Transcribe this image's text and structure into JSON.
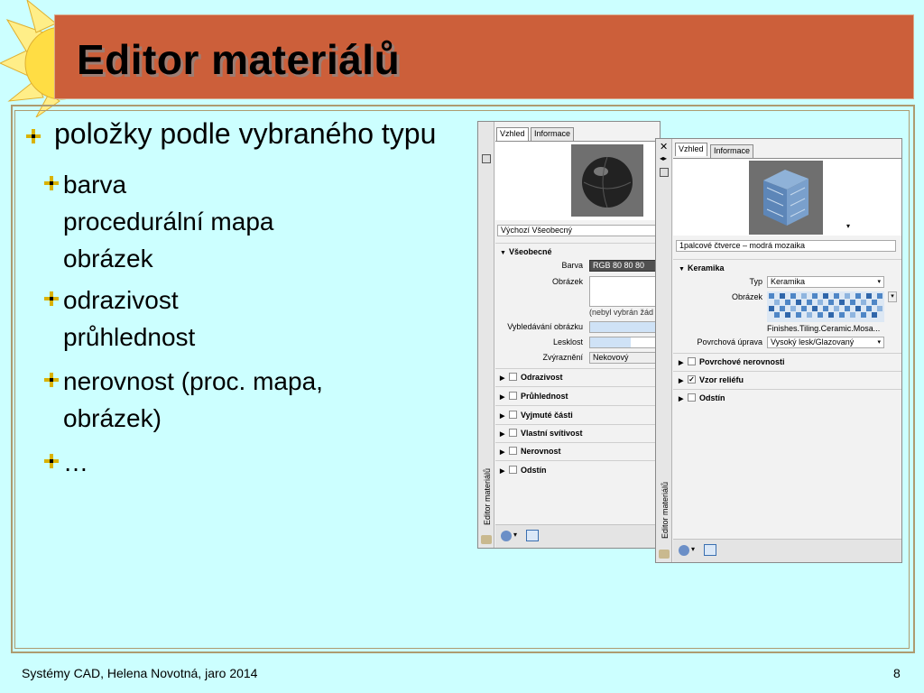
{
  "slide": {
    "title": "Editor materiálů",
    "bullets": {
      "level1": "položky podle vybraného typu",
      "groups": [
        {
          "lines": [
            "barva",
            "procedurální mapa",
            "obrázek"
          ]
        },
        {
          "lines": [
            "odrazivost",
            "průhlednost"
          ]
        },
        {
          "lines": [
            "nerovnost (proc. mapa,",
            "obrázek)"
          ]
        },
        {
          "lines": [
            "…"
          ]
        }
      ]
    },
    "footer": {
      "left": "Systémy CAD, Helena Novotná, jaro 2014",
      "page": "8"
    }
  },
  "palette1": {
    "side_title": "Editor materiálů",
    "tabs": [
      "Vzhled",
      "Informace"
    ],
    "material_name": "Výchozí Všeobecný",
    "section": "Všeobecné",
    "barva_label": "Barva",
    "barva_value": "RGB 80 80 80",
    "obrazek_label": "Obrázek",
    "obrazek_note": "(nebyl vybrán žád",
    "vybled_label": "Vybledávání obrázku",
    "lesk_label": "Lesklost",
    "zvyr_label": "Zvýraznění",
    "zvyr_value": "Nekovový",
    "groups": [
      "Odrazivost",
      "Průhlednost",
      "Vyjmuté části",
      "Vlastní svítivost",
      "Nerovnost",
      "Odstín"
    ]
  },
  "palette2": {
    "side_title": "Editor materiálů",
    "tabs": [
      "Vzhled",
      "Informace"
    ],
    "material_name": "1palcové čtverce – modrá mozaika",
    "section": "Keramika",
    "typ_label": "Typ",
    "typ_value": "Keramika",
    "obrazek_label": "Obrázek",
    "obrazek_file": "Finishes.Tiling.Ceramic.Mosa...",
    "povrch_label": "Povrchová úprava",
    "povrch_value": "Vysoký lesk/Glazovaný",
    "groups": [
      "Povrchové nerovnosti",
      "Vzor reliéfu",
      "Odstín"
    ],
    "close_glyph": "✕"
  }
}
